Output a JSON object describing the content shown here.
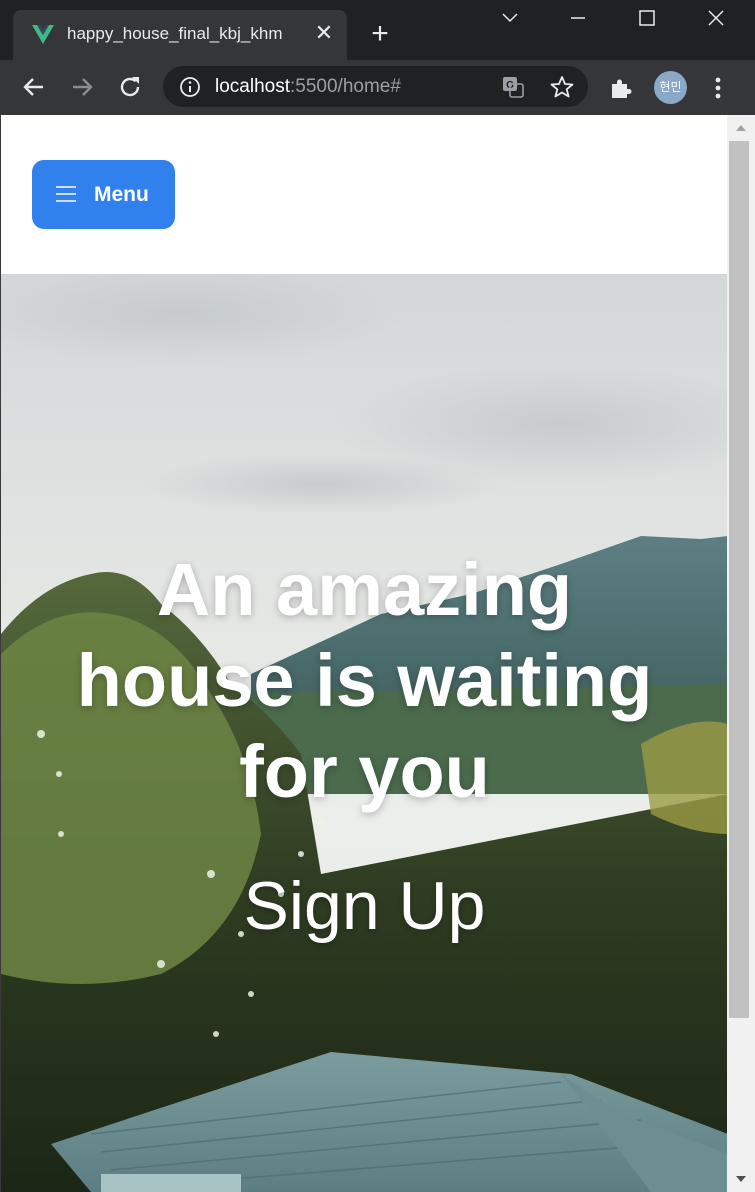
{
  "tab": {
    "title": "happy_house_final_kbj_khm",
    "favicon": "vue-logo-icon",
    "close_glyph": "✕"
  },
  "newtab_glyph": "+",
  "omnibox": {
    "host": "localhost",
    "rest": ":5500/home#"
  },
  "profile": {
    "initials": "현민"
  },
  "page": {
    "menu_label": "Menu",
    "hero_title_lines": [
      "An amazing",
      "house is waiting",
      "for you"
    ],
    "signup_label": "Sign Up"
  },
  "colors": {
    "menu_button": "#3080ee",
    "vue_green": "#41b883",
    "chrome_dark": "#202124",
    "chrome_bar": "#35363a"
  }
}
